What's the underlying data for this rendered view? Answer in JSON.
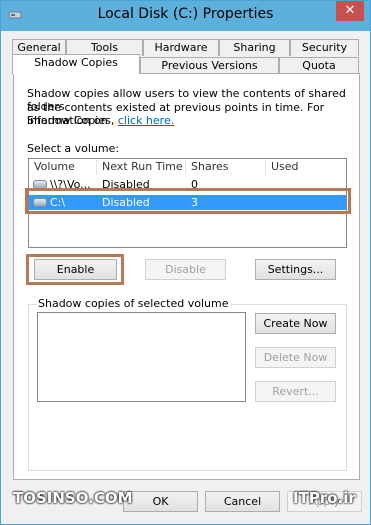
{
  "window": {
    "title": "Local Disk (C:) Properties",
    "close_glyph": "✕"
  },
  "tabs": {
    "row1": [
      "General",
      "Tools",
      "Hardware",
      "Sharing",
      "Security"
    ],
    "row2": [
      "Shadow Copies",
      "Previous Versions",
      "Quota"
    ],
    "selected": "Shadow Copies"
  },
  "description": {
    "line1": "Shadow copies allow users to view the contents of shared folders",
    "line2": "as the contents existed at previous points in time. For information on",
    "line3_prefix": "Shadow Copies,",
    "link": "click here."
  },
  "volume_list": {
    "label": "Select a volume:",
    "columns": [
      "Volume",
      "Next Run Time",
      "Shares",
      "Used"
    ],
    "rows": [
      {
        "volume": "\\\\?\\Vo...",
        "next_run": "Disabled",
        "shares": "0",
        "used": ""
      },
      {
        "volume": "C:\\",
        "next_run": "Disabled",
        "shares": "3",
        "used": ""
      }
    ],
    "selected_index": 1
  },
  "buttons": {
    "enable": "Enable",
    "disable": "Disable",
    "settings": "Settings...",
    "create_now": "Create Now",
    "delete_now": "Delete Now",
    "revert": "Revert...",
    "ok": "OK",
    "cancel": "Cancel",
    "apply": "Apply"
  },
  "copies_group": {
    "label": "Shadow copies of selected volume"
  },
  "watermark": {
    "left": "TOSINSO.COM",
    "right": "ITPro.ir"
  },
  "colors": {
    "highlight_border": "#b57a53",
    "selection": "#3399ff",
    "titlebar": "#5db0dc"
  }
}
